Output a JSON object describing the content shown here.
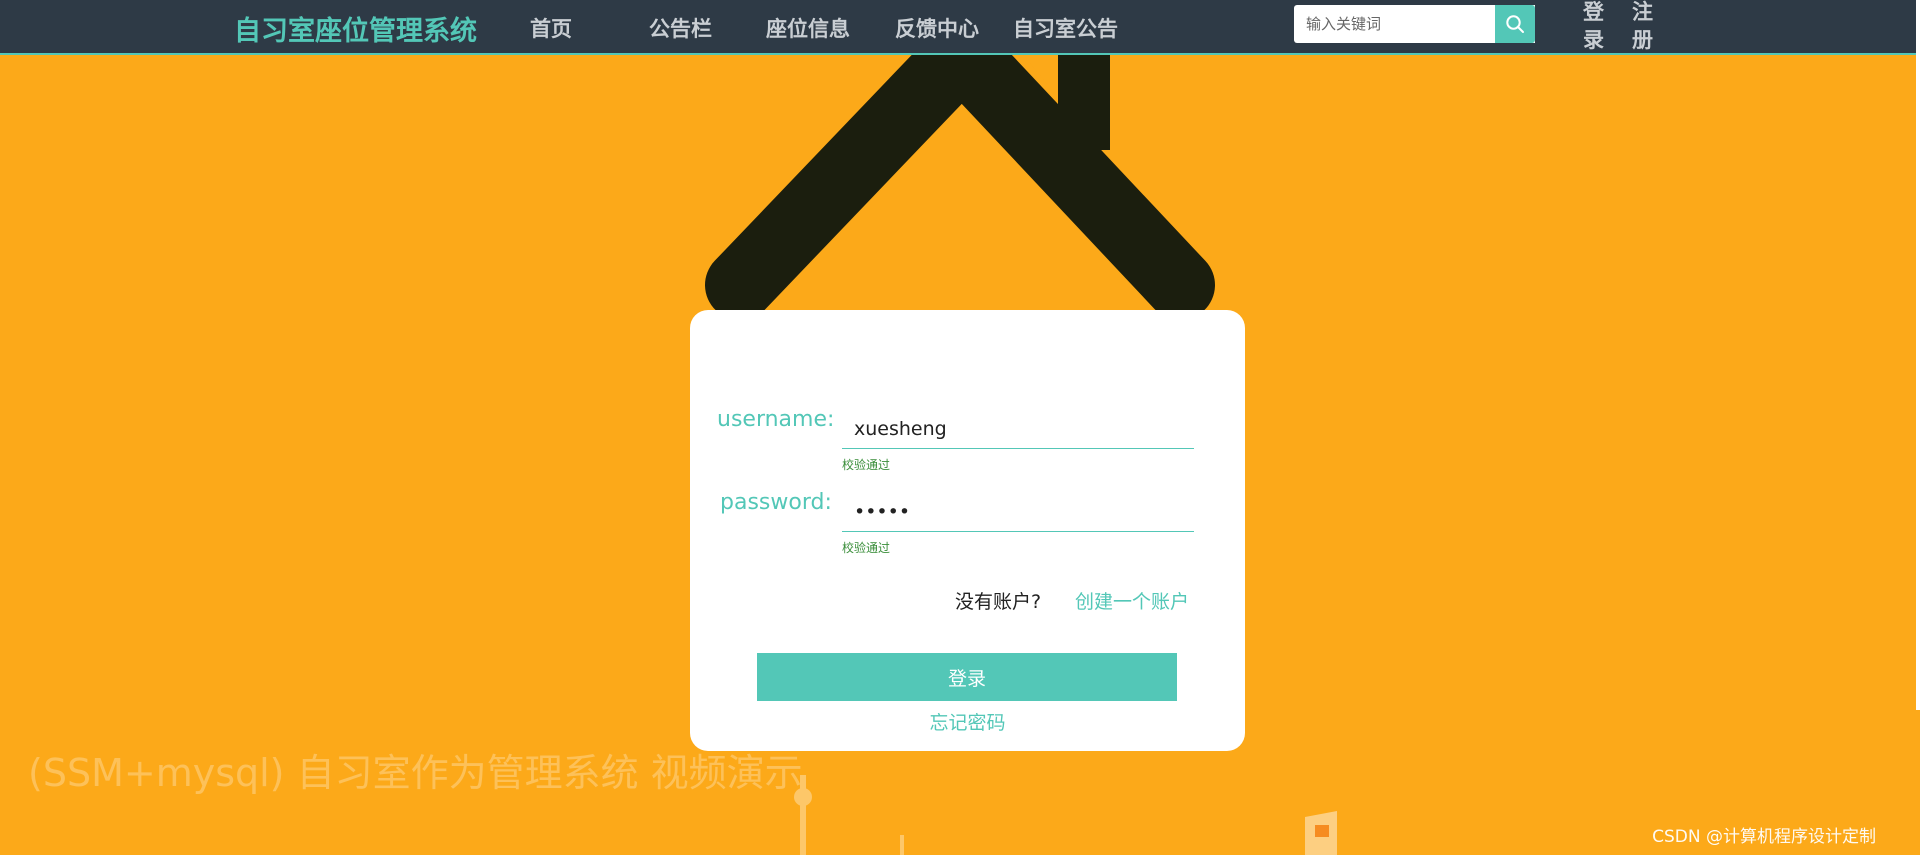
{
  "nav": {
    "brand": "自习室座位管理系统",
    "items": [
      "首页",
      "公告栏",
      "座位信息",
      "反馈中心",
      "自习室公告"
    ],
    "search_placeholder": "输入关键词",
    "login_line1": "登",
    "login_line2": "录",
    "register_line1": "注",
    "register_line2": "册"
  },
  "login": {
    "username_label": "username:",
    "username_value": "xuesheng",
    "username_status": "校验通过",
    "password_label": "password:",
    "password_value": "•••••",
    "password_status": "校验通过",
    "no_account": "没有账户?",
    "create_account": "创建一个账户",
    "submit": "登录",
    "forgot": "忘记密码"
  },
  "overlay": {
    "watermark": "(SSM+mysql) 自习室作为管理系统 视频演示",
    "credit": "CSDN @计算机程序设计定制"
  },
  "colors": {
    "accent": "#53C7B7",
    "nav_bg": "#2E3A46",
    "page_bg": "#FCA919",
    "valid": "#3A8E3A"
  }
}
